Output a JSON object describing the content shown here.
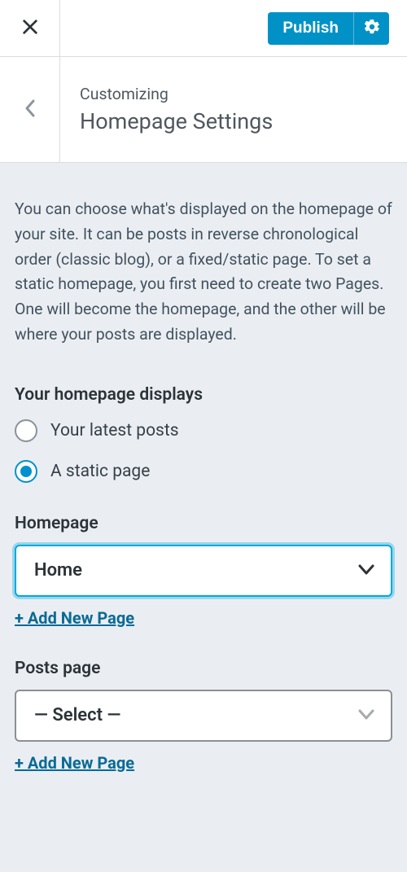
{
  "topbar": {
    "publish_label": "Publish"
  },
  "header": {
    "eyebrow": "Customizing",
    "title": "Homepage Settings"
  },
  "description": "You can choose what's displayed on the homepage of your site. It can be posts in reverse chronological order (classic blog), or a fixed/static page. To set a static homepage, you first need to create two Pages. One will become the homepage, and the other will be where your posts are displayed.",
  "displays": {
    "heading": "Your homepage displays",
    "options": [
      {
        "label": "Your latest posts",
        "checked": false
      },
      {
        "label": "A static page",
        "checked": true
      }
    ]
  },
  "homepage": {
    "label": "Homepage",
    "value": "Home",
    "add_link": "+ Add New Page"
  },
  "posts_page": {
    "label": "Posts page",
    "value": "— Select —",
    "add_link": "+ Add New Page"
  }
}
